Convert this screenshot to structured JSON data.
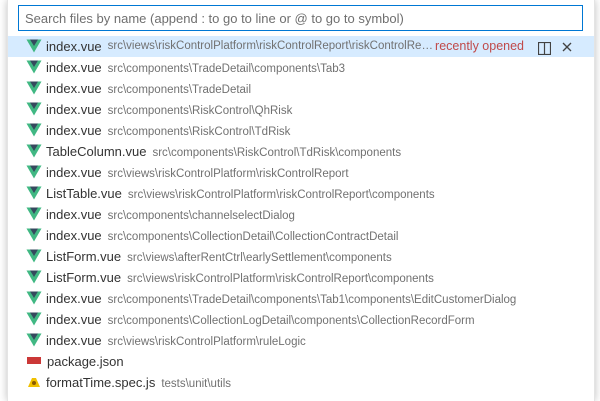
{
  "search": {
    "placeholder": "Search files by name (append : to go to line or @ to go to symbol)",
    "value": ""
  },
  "selected_row": {
    "recently_opened_label": "recently opened"
  },
  "icons": {
    "vue_color": "#41b883",
    "vue_dark": "#35495e",
    "npm_color": "#cb3837",
    "js_color": "#f0c000"
  },
  "files": [
    {
      "name": "index.vue",
      "path": "src\\views\\riskControlPlatform\\riskControlReport\\riskControlReport",
      "icon": "vue-icon"
    },
    {
      "name": "index.vue",
      "path": "src\\components\\TradeDetail\\components\\Tab3",
      "icon": "vue-icon"
    },
    {
      "name": "index.vue",
      "path": "src\\components\\TradeDetail",
      "icon": "vue-icon"
    },
    {
      "name": "index.vue",
      "path": "src\\components\\RiskControl\\QhRisk",
      "icon": "vue-icon"
    },
    {
      "name": "index.vue",
      "path": "src\\components\\RiskControl\\TdRisk",
      "icon": "vue-icon"
    },
    {
      "name": "TableColumn.vue",
      "path": "src\\components\\RiskControl\\TdRisk\\components",
      "icon": "vue-icon"
    },
    {
      "name": "index.vue",
      "path": "src\\views\\riskControlPlatform\\riskControlReport",
      "icon": "vue-icon"
    },
    {
      "name": "ListTable.vue",
      "path": "src\\views\\riskControlPlatform\\riskControlReport\\components",
      "icon": "vue-icon"
    },
    {
      "name": "index.vue",
      "path": "src\\components\\channelselectDialog",
      "icon": "vue-icon"
    },
    {
      "name": "index.vue",
      "path": "src\\components\\CollectionDetail\\CollectionContractDetail",
      "icon": "vue-icon"
    },
    {
      "name": "ListForm.vue",
      "path": "src\\views\\afterRentCtrl\\earlySettlement\\components",
      "icon": "vue-icon"
    },
    {
      "name": "ListForm.vue",
      "path": "src\\views\\riskControlPlatform\\riskControlReport\\components",
      "icon": "vue-icon"
    },
    {
      "name": "index.vue",
      "path": "src\\components\\TradeDetail\\components\\Tab1\\components\\EditCustomerDialog",
      "icon": "vue-icon"
    },
    {
      "name": "index.vue",
      "path": "src\\components\\CollectionLogDetail\\components\\CollectionRecordForm",
      "icon": "vue-icon"
    },
    {
      "name": "index.vue",
      "path": "src\\views\\riskControlPlatform\\ruleLogic",
      "icon": "vue-icon"
    },
    {
      "name": "package.json",
      "path": "",
      "icon": "npm-icon"
    },
    {
      "name": "formatTime.spec.js",
      "path": "tests\\unit\\utils",
      "icon": "js-test-icon"
    }
  ]
}
